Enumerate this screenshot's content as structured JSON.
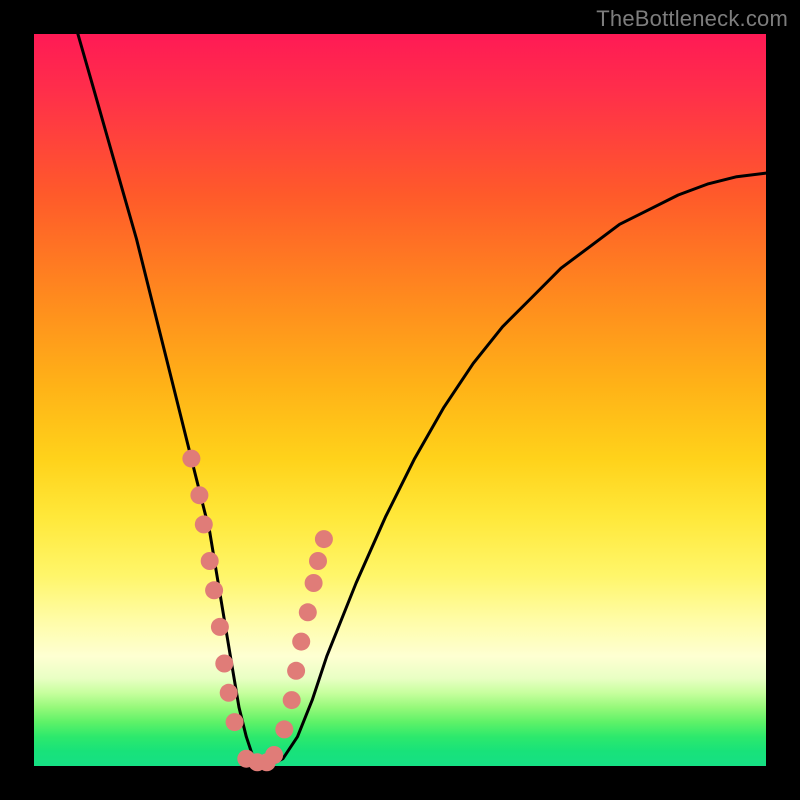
{
  "watermark": "TheBottleneck.com",
  "chart_data": {
    "type": "line",
    "title": "",
    "xlabel": "",
    "ylabel": "",
    "xlim": [
      0,
      100
    ],
    "ylim": [
      0,
      100
    ],
    "grid": false,
    "legend": false,
    "series": [
      {
        "name": "bottleneck-curve",
        "color": "#000000",
        "x": [
          6,
          8,
          10,
          12,
          14,
          16,
          18,
          20,
          22,
          24,
          25,
          26,
          27,
          28,
          29,
          30,
          32,
          34,
          36,
          38,
          40,
          44,
          48,
          52,
          56,
          60,
          64,
          68,
          72,
          76,
          80,
          84,
          88,
          92,
          96,
          100
        ],
        "y": [
          100,
          93,
          86,
          79,
          72,
          64,
          56,
          48,
          40,
          32,
          26,
          20,
          14,
          8,
          4,
          1,
          0,
          1,
          4,
          9,
          15,
          25,
          34,
          42,
          49,
          55,
          60,
          64,
          68,
          71,
          74,
          76,
          78,
          79.5,
          80.5,
          81
        ]
      },
      {
        "name": "highlight-dots",
        "color": "#e07c78",
        "type": "scatter",
        "x": [
          21.5,
          22.6,
          23.2,
          24.0,
          24.6,
          25.4,
          26.0,
          26.6,
          27.4,
          29.0,
          30.5,
          31.8,
          32.8,
          34.2,
          35.2,
          35.8,
          36.5,
          37.4,
          38.2,
          38.8,
          39.6
        ],
        "y": [
          42,
          37,
          33,
          28,
          24,
          19,
          14,
          10,
          6,
          1,
          0.5,
          0.5,
          1.5,
          5,
          9,
          13,
          17,
          21,
          25,
          28,
          31
        ]
      }
    ]
  },
  "colors": {
    "frame": "#000000",
    "curve": "#000000",
    "dot_fill": "#e07c78",
    "watermark": "#7d7d7d"
  }
}
